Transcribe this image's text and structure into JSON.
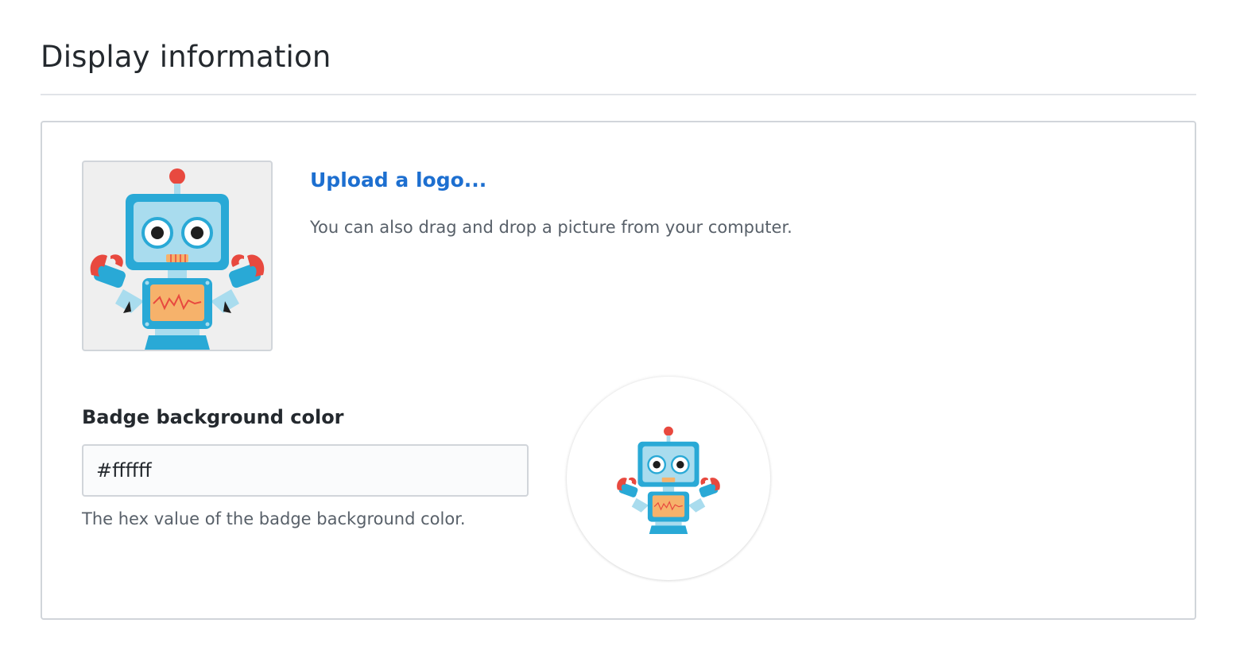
{
  "section": {
    "title": "Display information"
  },
  "logo": {
    "upload_label": "Upload a logo...",
    "upload_hint": "You can also drag and drop a picture from your computer.",
    "icon": "robot-logo"
  },
  "badge": {
    "label": "Badge background color",
    "value": "#ffffff",
    "hint": "The hex value of the badge background color.",
    "preview_background": "#ffffff"
  },
  "colors": {
    "link": "#1d6fd0",
    "robot_blue": "#29a9d6",
    "robot_light": "#a9dcee",
    "robot_red": "#e8493f",
    "robot_orange": "#f6b26b"
  }
}
